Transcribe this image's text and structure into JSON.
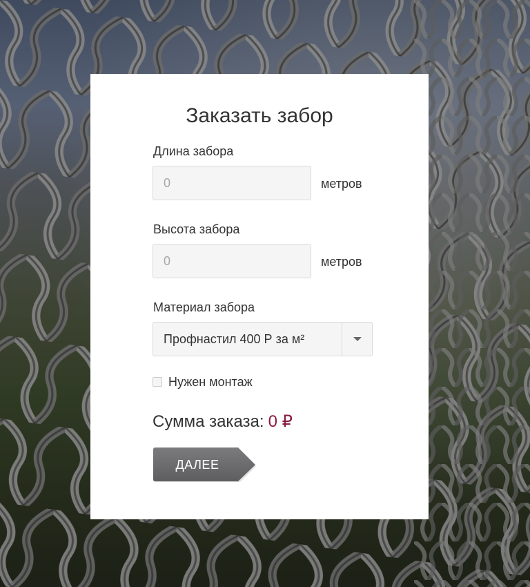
{
  "form": {
    "title": "Заказать забор",
    "length": {
      "label": "Длина забора",
      "placeholder": "0",
      "unit": "метров"
    },
    "height": {
      "label": "Высота забора",
      "placeholder": "0",
      "unit": "метров"
    },
    "material": {
      "label": "Материал забора",
      "selected": "Профнастил 400 Р за м²"
    },
    "installation": {
      "label": "Нужен монтаж",
      "checked": false
    },
    "total": {
      "label": "Сумма заказа:",
      "value": "0 ₽"
    },
    "next_label": "ДАЛЕЕ"
  },
  "colors": {
    "accent": "#8b1a3e",
    "button": "#6e6e70",
    "card": "#ffffff"
  }
}
